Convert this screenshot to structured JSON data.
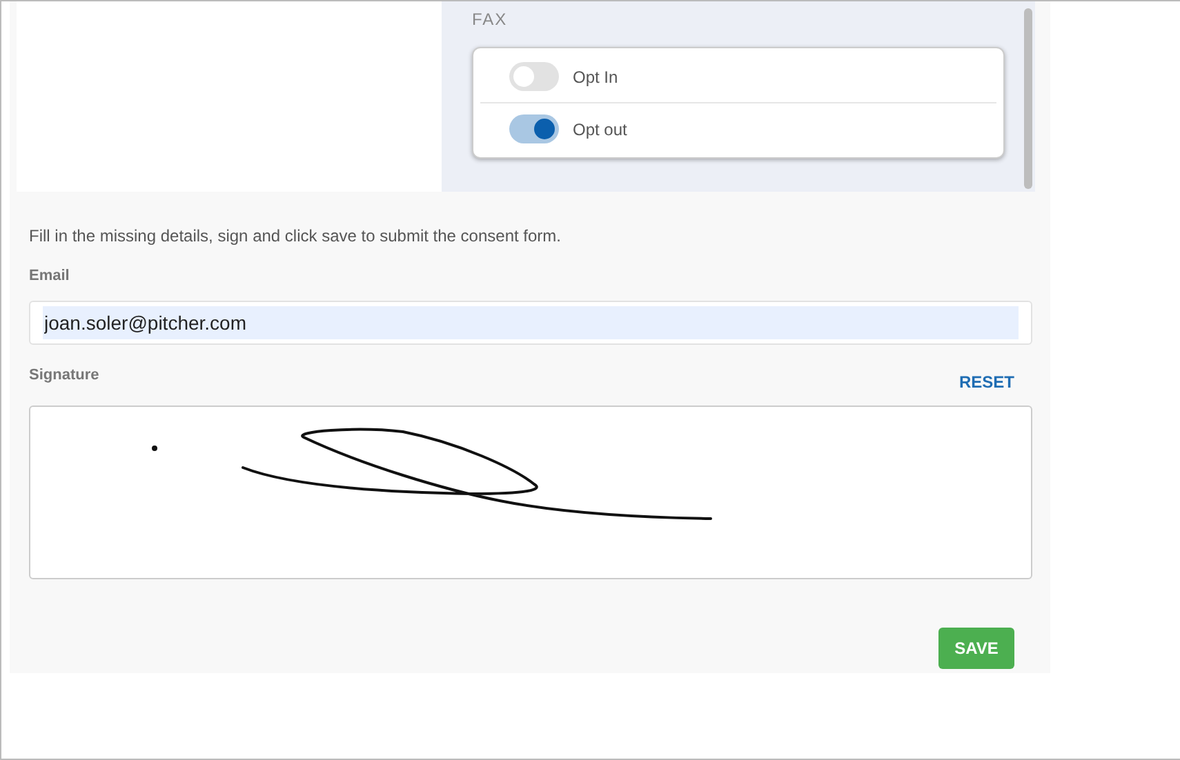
{
  "fax": {
    "label": "FAX",
    "options": [
      {
        "label": "Opt In",
        "on": false
      },
      {
        "label": "Opt out",
        "on": true
      }
    ]
  },
  "instructions": "Fill in the missing details, sign and click save to submit the consent form.",
  "email": {
    "label": "Email",
    "value": "joan.soler@pitcher.com"
  },
  "signature": {
    "label": "Signature",
    "reset": "RESET"
  },
  "save": "SAVE"
}
